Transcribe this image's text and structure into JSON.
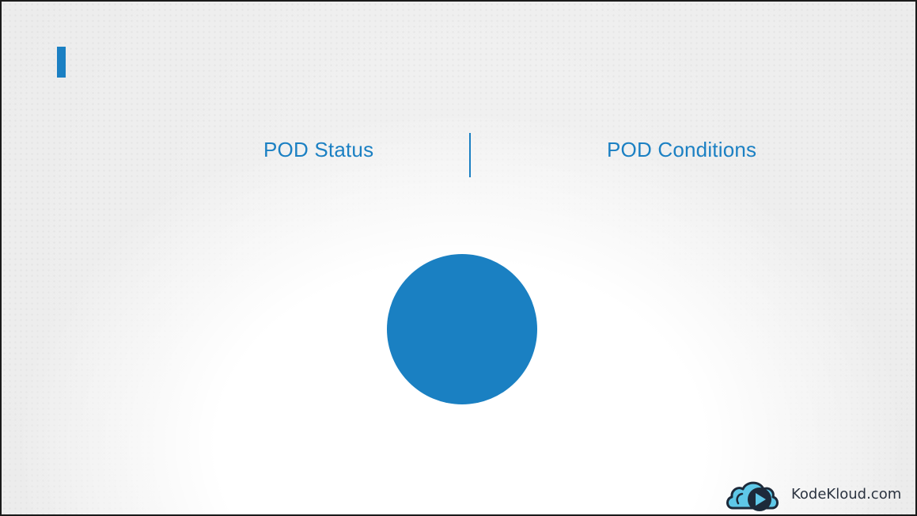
{
  "slide": {
    "headings": {
      "left": "POD Status",
      "right": "POD Conditions"
    }
  },
  "brand": {
    "name": "KodeKloud.com",
    "logo_icon": "cloud-play-icon"
  },
  "colors": {
    "accent": "#1b80c3",
    "pod_circle": "#1a80c2",
    "logo_dark": "#1d2a3a",
    "logo_light": "#5ec8e8"
  }
}
